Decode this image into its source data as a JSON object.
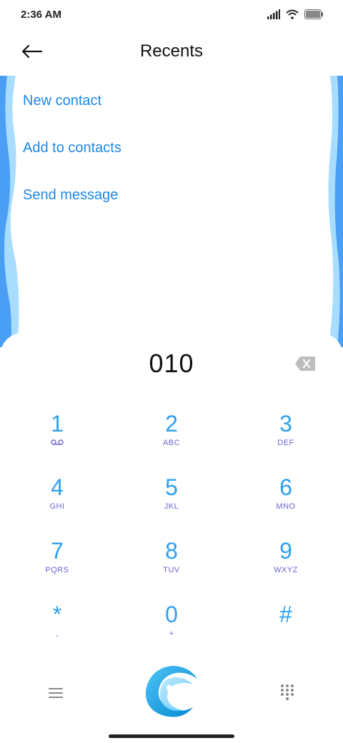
{
  "status_bar": {
    "time": "2:36 AM"
  },
  "header": {
    "title": "Recents"
  },
  "actions": [
    {
      "label": "New contact"
    },
    {
      "label": "Add to contacts"
    },
    {
      "label": "Send message"
    }
  ],
  "dialer": {
    "number": "010",
    "keys": [
      {
        "digit": "1",
        "sub": "voicemail-icon"
      },
      {
        "digit": "2",
        "sub": "ABC"
      },
      {
        "digit": "3",
        "sub": "DEF"
      },
      {
        "digit": "4",
        "sub": "GHI"
      },
      {
        "digit": "5",
        "sub": "JKL"
      },
      {
        "digit": "6",
        "sub": "MNO"
      },
      {
        "digit": "7",
        "sub": "PQRS"
      },
      {
        "digit": "8",
        "sub": "TUV"
      },
      {
        "digit": "9",
        "sub": "WXYZ"
      },
      {
        "digit": "*",
        "sub": ","
      },
      {
        "digit": "0",
        "sub": "+"
      },
      {
        "digit": "#",
        "sub": ""
      }
    ]
  },
  "colors": {
    "accent": "#1e88e5",
    "digit": "#2ea0f0",
    "letters": "#6a64d8",
    "side_dark": "#4a9ff5",
    "side_light": "#a8ddff"
  }
}
